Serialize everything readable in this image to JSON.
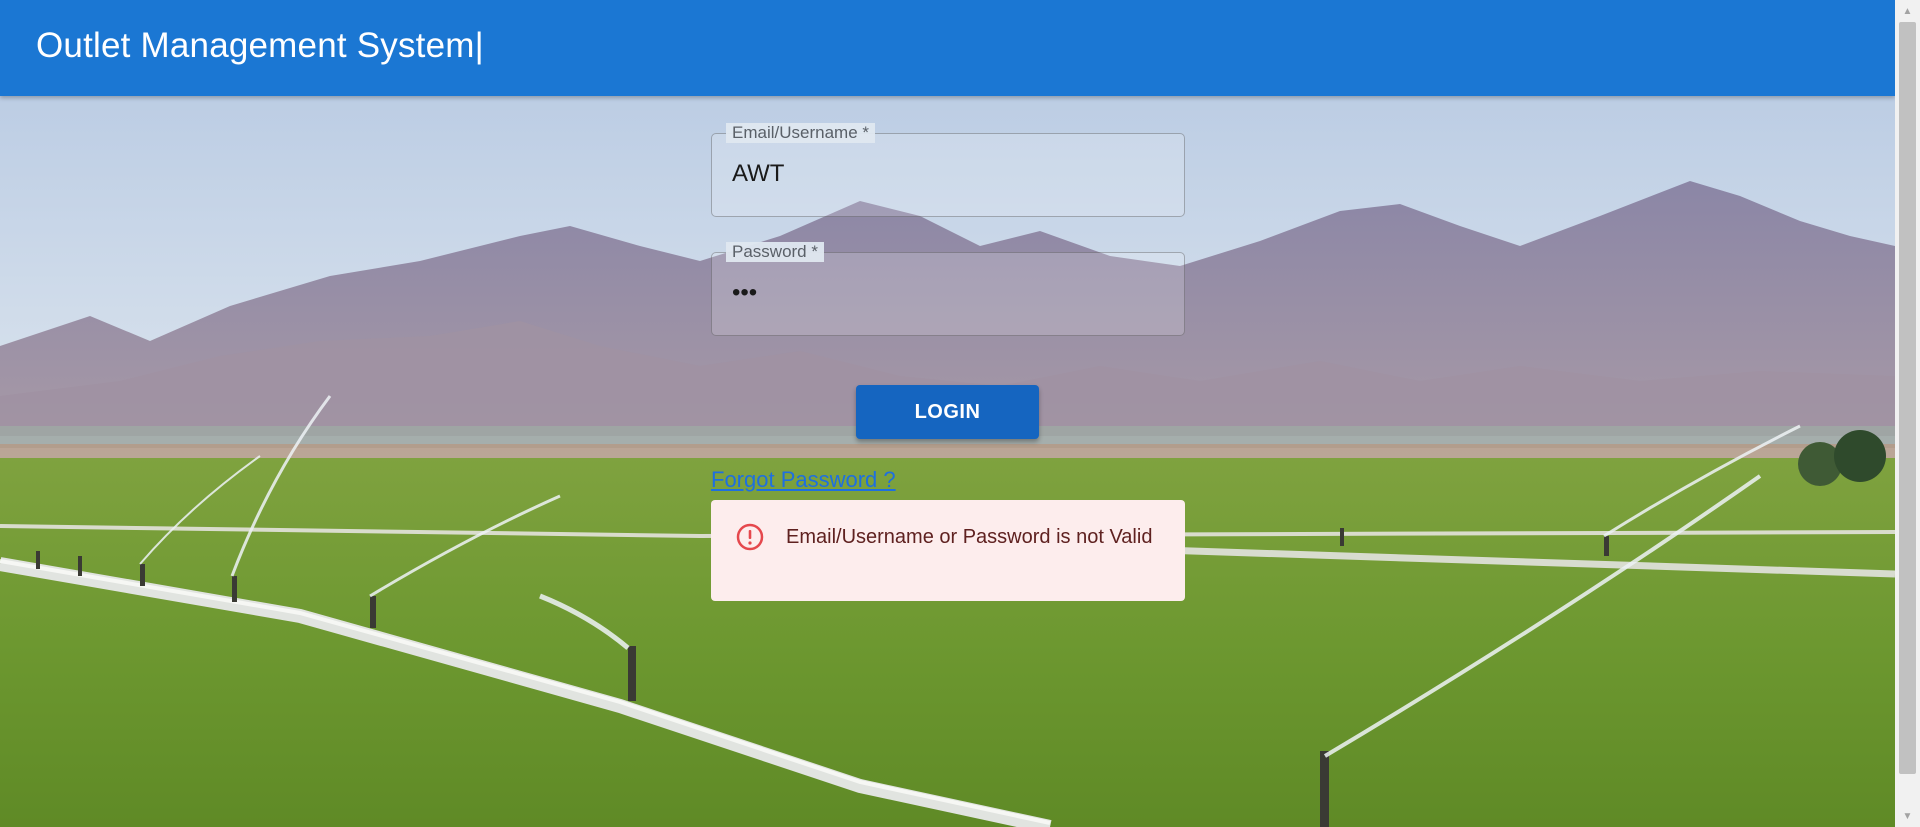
{
  "app": {
    "title": "Outlet Management System|"
  },
  "login_form": {
    "email": {
      "label": "Email/Username *",
      "value": "AWT"
    },
    "password": {
      "label": "Password *",
      "value": "•••"
    },
    "login_button": "LOGIN",
    "forgot_link": "Forgot Password ?",
    "error_alert": {
      "icon": "error-outline-icon",
      "message": "Email/Username or Password is not Valid"
    }
  },
  "background": {
    "description_icon": "irrigation-field-photo",
    "sky_color": "#c9d8ea",
    "mountain_color": "#8f8aa8",
    "grass_color": "#6f9a33"
  },
  "colors": {
    "appbar": "#1b77d3",
    "button": "#1565c0",
    "link": "#1e6fe0",
    "alert_bg": "#fdeded",
    "alert_icon": "#e5484d"
  }
}
